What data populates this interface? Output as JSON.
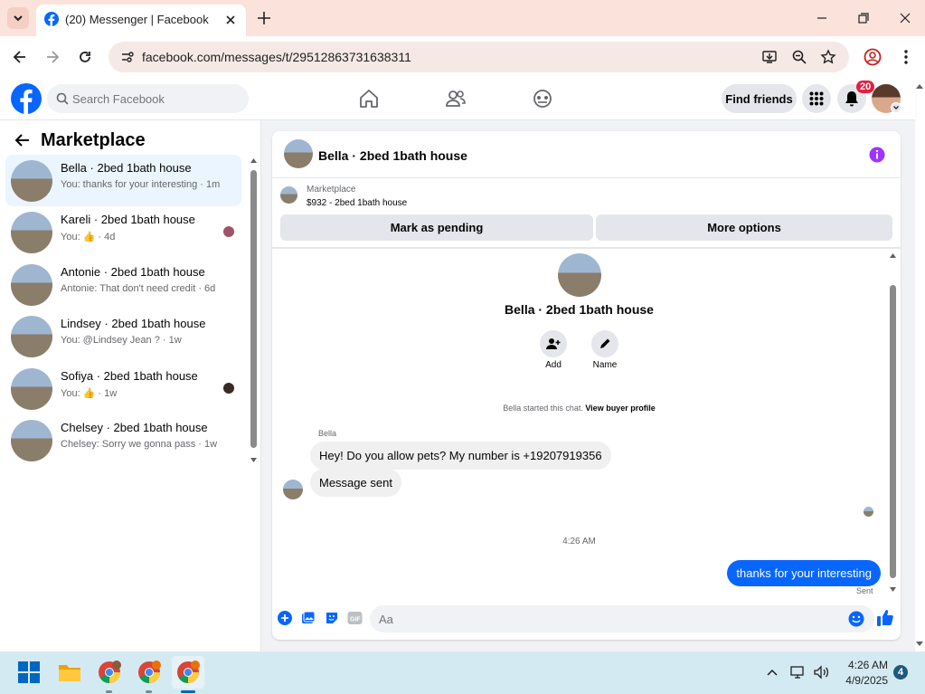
{
  "browser": {
    "tab_title": "(20) Messenger | Facebook",
    "url": "facebook.com/messages/t/29512863731638311"
  },
  "fb": {
    "search_placeholder": "Search Facebook",
    "find_friends": "Find friends",
    "notification_count": "20"
  },
  "sidebar": {
    "title": "Marketplace",
    "conversations": [
      {
        "name": "Bella · 2bed 1bath house",
        "snippet": "You: thanks for your interesting · 1m",
        "selected": true
      },
      {
        "name": "Kareli · 2bed 1bath house",
        "snippet": "You: 👍 · 4d"
      },
      {
        "name": "Antonie · 2bed 1bath house",
        "snippet": "Antonie: That don't need credit · 6d"
      },
      {
        "name": "Lindsey · 2bed 1bath house",
        "snippet": "You: @Lindsey Jean ? · 1w"
      },
      {
        "name": "Sofiya · 2bed 1bath house",
        "snippet": "You: 👍 · 1w"
      },
      {
        "name": "Chelsey · 2bed 1bath house",
        "snippet": "Chelsey: Sorry we gonna pass · 1w"
      }
    ]
  },
  "chat": {
    "header_title": "Bella · 2bed 1bath house",
    "listing_source": "Marketplace",
    "listing_price": "$932 - 2bed 1bath house",
    "mark_pending": "Mark as pending",
    "more_options": "More options",
    "profile_name": "Bella · 2bed 1bath house",
    "add_label": "Add",
    "name_label": "Name",
    "started_text": "Bella started this chat.",
    "view_profile": "View buyer profile",
    "sender_name": "Bella",
    "messages_in": [
      "Hey! Do you allow pets? My number is +19207919356",
      "Message sent"
    ],
    "timestamp": "4:26 AM",
    "message_out": "thanks for your interesting",
    "sent_status": "Sent",
    "composer_placeholder": "Aa"
  },
  "taskbar": {
    "time": "4:26 AM",
    "date": "4/9/2025",
    "notif_count": "4"
  },
  "colors": {
    "fb_blue": "#0866ff",
    "accent_purple": "#a033ff",
    "badge_red": "#e41e3f"
  }
}
